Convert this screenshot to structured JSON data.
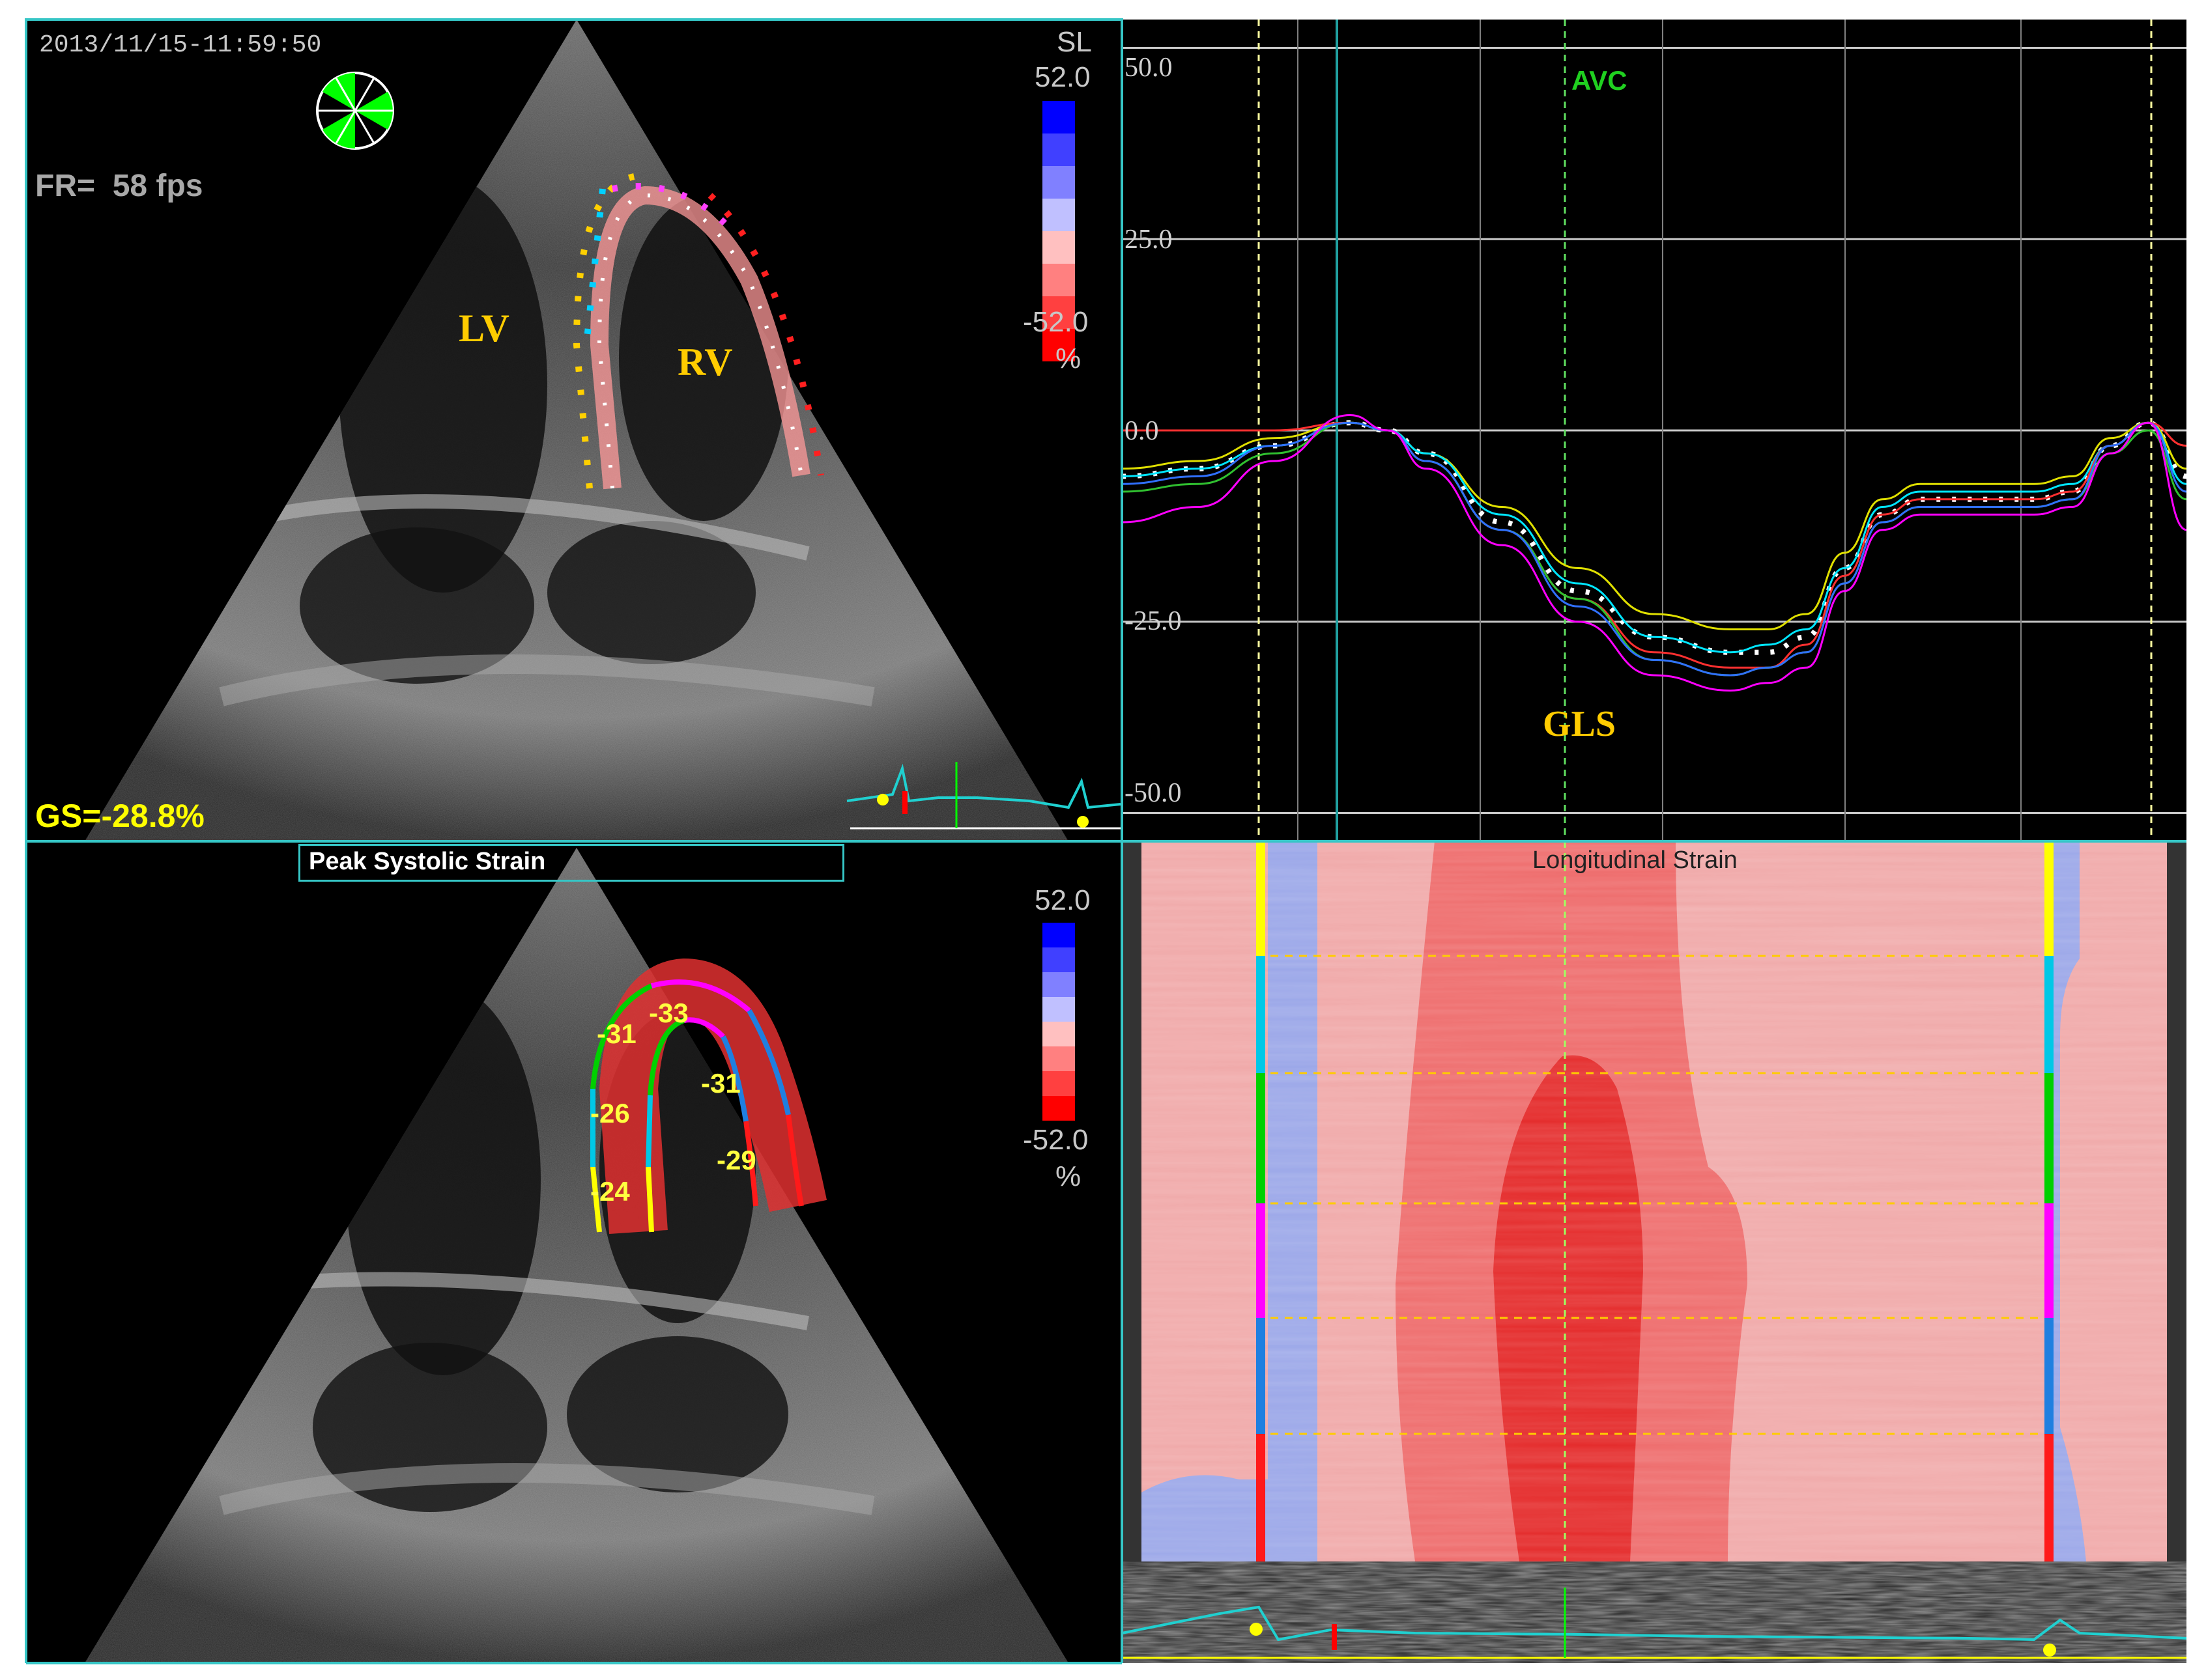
{
  "top_left": {
    "timestamp": "2013/11/15-11:59:50",
    "frame_rate": "FR=  58 fps",
    "scale_label": "SL",
    "scale_max": "52.0",
    "scale_min": "-52.0",
    "scale_unit": "%",
    "lv_label": "LV",
    "rv_label": "RV",
    "global_strain": "GS=-28.8%"
  },
  "bottom_left": {
    "title": "Peak Systolic Strain",
    "scale_max": "52.0",
    "scale_min": "-52.0",
    "scale_unit": "%",
    "segments": [
      {
        "label": "-24",
        "color": "#ffff00"
      },
      {
        "label": "-26",
        "color": "#00c8e6"
      },
      {
        "label": "-31",
        "color": "#00d000"
      },
      {
        "label": "-33",
        "color": "#ff00ff"
      },
      {
        "label": "-31",
        "color": "#1f7fe0"
      },
      {
        "label": "-29",
        "color": "#ff1a1a"
      }
    ]
  },
  "top_right": {
    "event_label": "AVC",
    "curve_label": "GLS",
    "chart_data": {
      "type": "line",
      "title": "",
      "xlabel": "",
      "ylabel": "",
      "ylim": [
        -52,
        52
      ],
      "yticks": [
        "50.0",
        "25.0",
        "0.0",
        "-25.0",
        "-50.0"
      ],
      "ytick_values": [
        50,
        25,
        0,
        -25,
        -50
      ],
      "x": [
        0,
        2,
        4,
        6,
        7,
        8,
        10,
        12,
        14,
        16,
        17,
        18,
        19,
        20,
        21,
        22,
        23,
        24,
        25,
        26,
        27,
        28
      ],
      "series": [
        {
          "color": "#ffffff",
          "dotted": true,
          "values": [
            -6,
            -5,
            -2,
            1,
            0,
            -3,
            -12,
            -21,
            -27,
            -29,
            -29,
            -27,
            -18,
            -11,
            -9,
            -9,
            -9,
            -9,
            -8,
            -2,
            1,
            -6
          ]
        },
        {
          "color": "#e0e000",
          "values": [
            -5,
            -4,
            -1,
            1,
            0,
            -3,
            -10,
            -18,
            -24,
            -26,
            -26,
            -24,
            -16,
            -9,
            -7,
            -7,
            -7,
            -7,
            -6,
            -1,
            1,
            -5
          ]
        },
        {
          "color": "#00e6ff",
          "values": [
            -6,
            -5,
            -2,
            1,
            0,
            -3,
            -11,
            -20,
            -27,
            -29,
            -28,
            -26,
            -18,
            -10,
            -8,
            -8,
            -8,
            -8,
            -7,
            -2,
            1,
            -7
          ]
        },
        {
          "color": "#ff3030",
          "values": [
            0,
            0,
            0,
            1,
            0,
            -4,
            -13,
            -22,
            -29,
            -31,
            -31,
            -28,
            -19,
            -11,
            -9,
            -9,
            -9,
            -9,
            -8,
            -2,
            1,
            -2
          ]
        },
        {
          "color": "#30c030",
          "values": [
            -8,
            -7,
            -3,
            1,
            0,
            -4,
            -13,
            -22,
            -30,
            -32,
            -31,
            -29,
            -20,
            -12,
            -10,
            -10,
            -10,
            -10,
            -9,
            -3,
            0,
            -9
          ]
        },
        {
          "color": "#3070ff",
          "values": [
            -7,
            -6,
            -2,
            1,
            0,
            -4,
            -13,
            -23,
            -30,
            -32,
            -31,
            -29,
            -20,
            -12,
            -10,
            -10,
            -10,
            -10,
            -9,
            -2,
            1,
            -8
          ]
        },
        {
          "color": "#ff00ff",
          "values": [
            -12,
            -10,
            -4,
            2,
            0,
            -5,
            -15,
            -25,
            -32,
            -34,
            -33,
            -31,
            -21,
            -13,
            -11,
            -11,
            -11,
            -11,
            -10,
            -3,
            1,
            -13
          ]
        }
      ]
    }
  },
  "bottom_right": {
    "title": "Longitudinal Strain"
  }
}
